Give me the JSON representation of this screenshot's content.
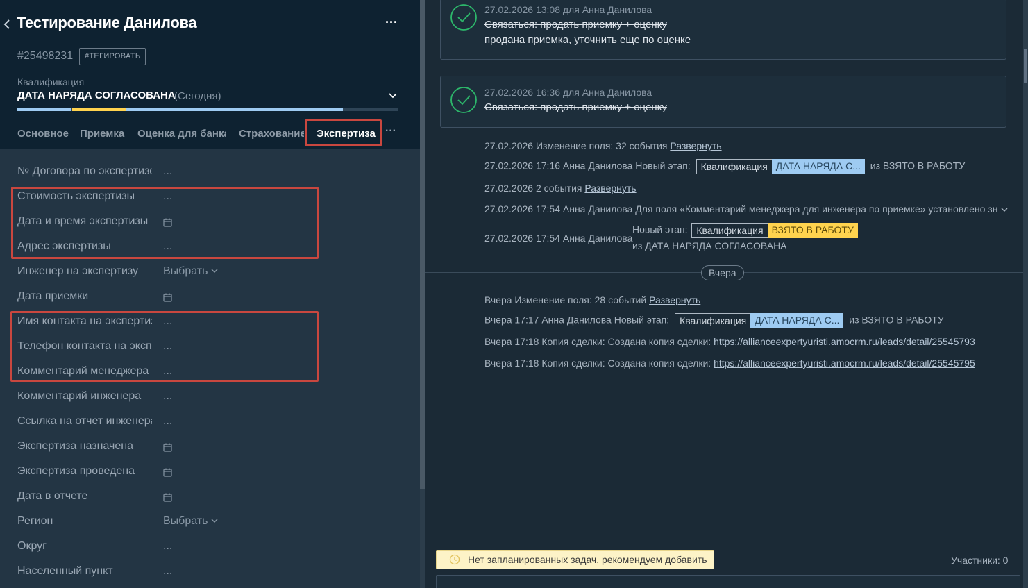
{
  "deal": {
    "title": "Тестирование Данилова",
    "id": "#25498231",
    "tag_button": "#ТЕГИРОВАТЬ",
    "pipeline": "Квалификация",
    "stage": "ДАТА НАРЯДА СОГЛАСОВАНА",
    "stage_when": "(Сегодня)",
    "progress_fraction": 0.85
  },
  "tabs": [
    {
      "label": "Основное"
    },
    {
      "label": "Приемка"
    },
    {
      "label": "Оценка для банка"
    },
    {
      "label": "Страхование"
    },
    {
      "label": "Экспертиза",
      "active": true
    }
  ],
  "fields": [
    {
      "label": "№ Договора по экспертизе",
      "value": "...",
      "kind": "text"
    },
    {
      "label": "Стоимость экспертизы",
      "value": "...",
      "kind": "text"
    },
    {
      "label": "Дата и время экспертизы",
      "value": "",
      "kind": "date"
    },
    {
      "label": "Адрес экспертизы",
      "value": "...",
      "kind": "text"
    },
    {
      "label": "Инженер на экспертизу",
      "value": "Выбрать",
      "kind": "select"
    },
    {
      "label": "Дата приемки",
      "value": "",
      "kind": "date"
    },
    {
      "label": "Имя контакта на экспертизе",
      "value": "...",
      "kind": "text"
    },
    {
      "label": "Телефон контакта на экспертизе",
      "value": "...",
      "kind": "text"
    },
    {
      "label": "Комментарий менеджера",
      "value": "...",
      "kind": "text"
    },
    {
      "label": "Комментарий инженера",
      "value": "...",
      "kind": "text"
    },
    {
      "label": "Ссылка на отчет инженера",
      "value": "...",
      "kind": "text"
    },
    {
      "label": "Экспертиза назначена",
      "value": "",
      "kind": "date"
    },
    {
      "label": "Экспертиза проведена",
      "value": "",
      "kind": "date"
    },
    {
      "label": "Дата в отчете",
      "value": "",
      "kind": "date"
    },
    {
      "label": "Регион",
      "value": "Выбрать",
      "kind": "select"
    },
    {
      "label": "Округ",
      "value": "...",
      "kind": "text"
    },
    {
      "label": "Населенный пункт",
      "value": "...",
      "kind": "text"
    }
  ],
  "feed": {
    "tasks": [
      {
        "meta": "27.02.2026 13:08  для Анна Данилова",
        "text": "Связаться: продать приемку + оценку",
        "result": "продана приемка, уточнить еще по оценке"
      },
      {
        "meta": "27.02.2026 16:36  для Анна Данилова",
        "text": "Связаться: продать приемку + оценку",
        "result": ""
      }
    ],
    "events_today": [
      {
        "text": "27.02.2026 Изменение поля: 32 события ",
        "link": "Развернуть"
      },
      {
        "text": "27.02.2026 17:16 Анна Данилова Новый этап:",
        "tag_a": "Квалификация",
        "tag_b": "ДАТА НАРЯДА С...",
        "tag_color": "blue",
        "after": " из ВЗЯТО В РАБОТУ"
      },
      {
        "text": "27.02.2026 2 события ",
        "link": "Развернуть"
      },
      {
        "text": "27.02.2026 17:54 Анна Данилова Для поля «Комментарий менеджера для инженера по приемке» установлено зн"
      },
      {
        "text": "27.02.2026 17:54 Анна Данилова",
        "line1": "Новый этап:",
        "tag_a": "Квалификация",
        "tag_b": "ВЗЯТО В РАБОТУ",
        "tag_color": "yellow",
        "line2": "из ДАТА НАРЯДА СОГЛАСОВАНА"
      }
    ],
    "day_separator": "Вчера",
    "events_yesterday": [
      {
        "text": "Вчера Изменение поля: 28 событий ",
        "link": "Развернуть"
      },
      {
        "text": "Вчера 17:17 Анна Данилова Новый этап:",
        "tag_a": "Квалификация",
        "tag_b": "ДАТА НАРЯДА С...",
        "tag_color": "blue",
        "after": " из ВЗЯТО В РАБОТУ"
      },
      {
        "text": "Вчера 17:18 Копия сделки: Создана копия сделки: ",
        "link": "https://allianceexpertyuristi.amocrm.ru/leads/detail/25545793"
      },
      {
        "text": "Вчера 17:18 Копия сделки: Создана копия сделки: ",
        "link": "https://allianceexpertyuristi.amocrm.ru/leads/detail/25545795"
      }
    ],
    "no_tasks_text": "Нет запланированных задач, рекомендуем ",
    "no_tasks_link": "добавить",
    "participants": "Участники: 0"
  },
  "colors": {
    "header_bg": "#0e2231",
    "panel_bg": "#233544",
    "feed_bg": "#1b2a36",
    "annotation": "#c9473f",
    "stage_blue": "#9ecbf2",
    "stage_yellow": "#ffd34e",
    "check_green": "#2db86b"
  }
}
